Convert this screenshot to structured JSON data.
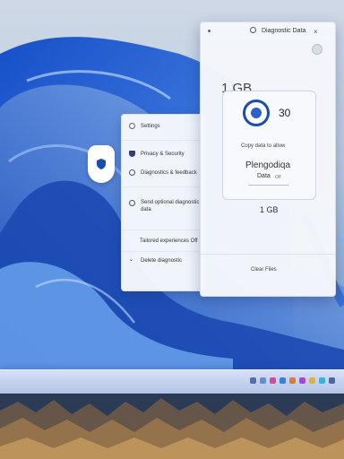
{
  "settings_panel": {
    "header": "Settings",
    "items": [
      {
        "label": "Privacy & Security",
        "icon": "shield-icon"
      },
      {
        "label": "Diagnostics & feedback",
        "icon": "feedback-icon"
      },
      {
        "label": "Send optional diagnostic",
        "sub": "data",
        "icon": "diagnostic-icon"
      },
      {
        "label": "Tailored experiences Off"
      },
      {
        "label": "Delete diagnostic",
        "icon": "delete-icon"
      }
    ]
  },
  "diagnostic_window": {
    "title": "Diagnostic Data",
    "avatar_label": "",
    "size_top": "1 GB",
    "ring_value": "30",
    "caption": "Copy data to allow",
    "heading": "Plengodiqa",
    "label": "Data",
    "sublabel": "Off",
    "size_bottom": "1 GB",
    "footer": "Clear Files"
  },
  "colors": {
    "accent": "#1a4db3",
    "wallpaper_blue": "#2a6ad8"
  }
}
